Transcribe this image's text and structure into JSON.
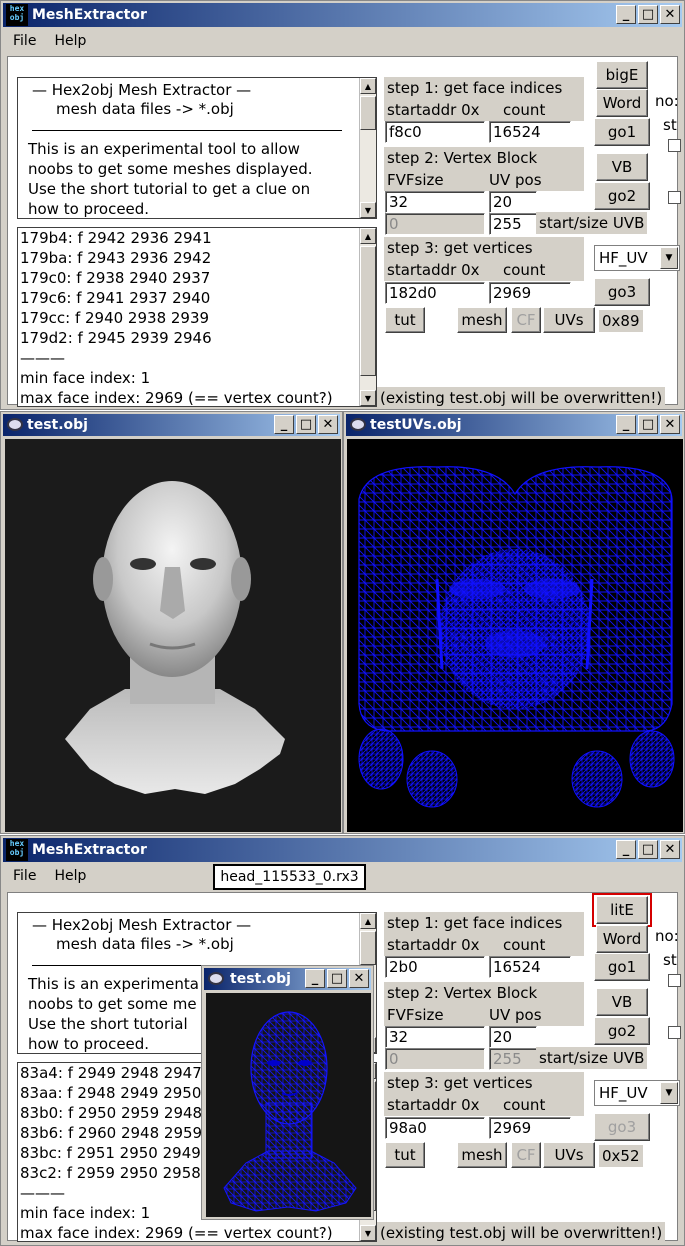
{
  "window1": {
    "title": "MeshExtractor",
    "icon_text": "hex obj",
    "menu": [
      "File",
      "Help"
    ],
    "info": {
      "line1": "—   Hex2obj Mesh Extractor   —",
      "line2": "mesh data files -> *.obj",
      "desc": [
        "This is an experimental tool to allow",
        "noobs to get some meshes displayed.",
        "Use the short tutorial to get a clue on",
        "how to proceed."
      ]
    },
    "log": {
      "lines": [
        "179b4: f  2942 2936 2941",
        "179ba: f  2943 2936 2942",
        "179c0: f  2938 2940 2937",
        "179c6: f  2941 2937 2940",
        "179cc: f  2940 2938 2939",
        "179d2: f  2945 2939 2946"
      ],
      "separator": "———",
      "min": "min face index: 1",
      "max": "max face index: 2969 (== vertex count?)"
    },
    "step1": {
      "label": "step 1: get face indices",
      "startaddr_label": "startaddr 0x",
      "count_label": "count",
      "startaddr": "f8c0",
      "count": "16524"
    },
    "step2": {
      "label": "step 2: Vertex Block",
      "fvf_label": "FVFsize",
      "uv_label": "UV pos",
      "fvf": "32",
      "uv": "20",
      "start_uvb": "0",
      "size_uvb": "255",
      "uvb_label": "start/size UVB"
    },
    "step3": {
      "label": "step 3: get vertices",
      "startaddr_label": "startaddr 0x",
      "count_label": "count",
      "startaddr": "182d0",
      "count": "2969"
    },
    "buttons": {
      "big": "bigE",
      "word": "Word",
      "go1": "go1",
      "vb": "VB",
      "go2": "go2",
      "go3": "go3",
      "tut": "tut",
      "mesh": "mesh",
      "cf": "CF",
      "uvs": "UVs"
    },
    "select": "HF_UV",
    "hex": "0x89",
    "cut1": "no:",
    "cut2": "st",
    "status": "(existing test.obj will be overwritten!)"
  },
  "viewer1": {
    "title": "test.obj"
  },
  "viewer2": {
    "title": "testUVs.obj"
  },
  "window2": {
    "title": "MeshExtractor",
    "icon_text": "hex obj",
    "menu": [
      "File",
      "Help"
    ],
    "file_label": "head_115533_0.rx3",
    "info": {
      "line1": "—   Hex2obj Mesh Extractor   —",
      "line2": "mesh data files -> *.obj",
      "desc": [
        "This is an experimenta",
        "noobs to get some me",
        "Use the short tutorial",
        "how to proceed."
      ]
    },
    "log": {
      "lines": [
        "83a4: f  2949 2948 2947",
        "83aa: f  2948 2949 2950",
        "83b0: f  2950 2959 2948",
        "83b6: f  2960 2948 2959",
        "83bc: f  2951 2950 2949",
        "83c2: f  2959 2950 2958"
      ],
      "separator": "———",
      "min": "min face index: 1",
      "max": "max face index: 2969 (== vertex count?)"
    },
    "step1": {
      "label": "step 1: get face indices",
      "startaddr_label": "startaddr 0x",
      "count_label": "count",
      "startaddr": "2b0",
      "count": "16524"
    },
    "step2": {
      "label": "step 2: Vertex Block",
      "fvf_label": "FVFsize",
      "uv_label": "UV pos",
      "fvf": "32",
      "uv": "20",
      "start_uvb": "0",
      "size_uvb": "255",
      "uvb_label": "start/size UVB"
    },
    "step3": {
      "label": "step 3: get vertices",
      "startaddr_label": "startaddr 0x",
      "count_label": "count",
      "startaddr": "98a0",
      "count": "2969"
    },
    "buttons": {
      "big": "litE",
      "word": "Word",
      "go1": "go1",
      "vb": "VB",
      "go2": "go2",
      "go3": "go3",
      "tut": "tut",
      "mesh": "mesh",
      "cf": "CF",
      "uvs": "UVs"
    },
    "select": "HF_UV",
    "hex": "0x52",
    "cut1": "no:",
    "cut2": "st",
    "status": "(existing test.obj will be overwritten!)"
  },
  "viewer3": {
    "title": "test.obj"
  },
  "colors": {
    "wire": "#1010ff",
    "highlight": "#d40000",
    "titlebar": "#0a246a"
  }
}
